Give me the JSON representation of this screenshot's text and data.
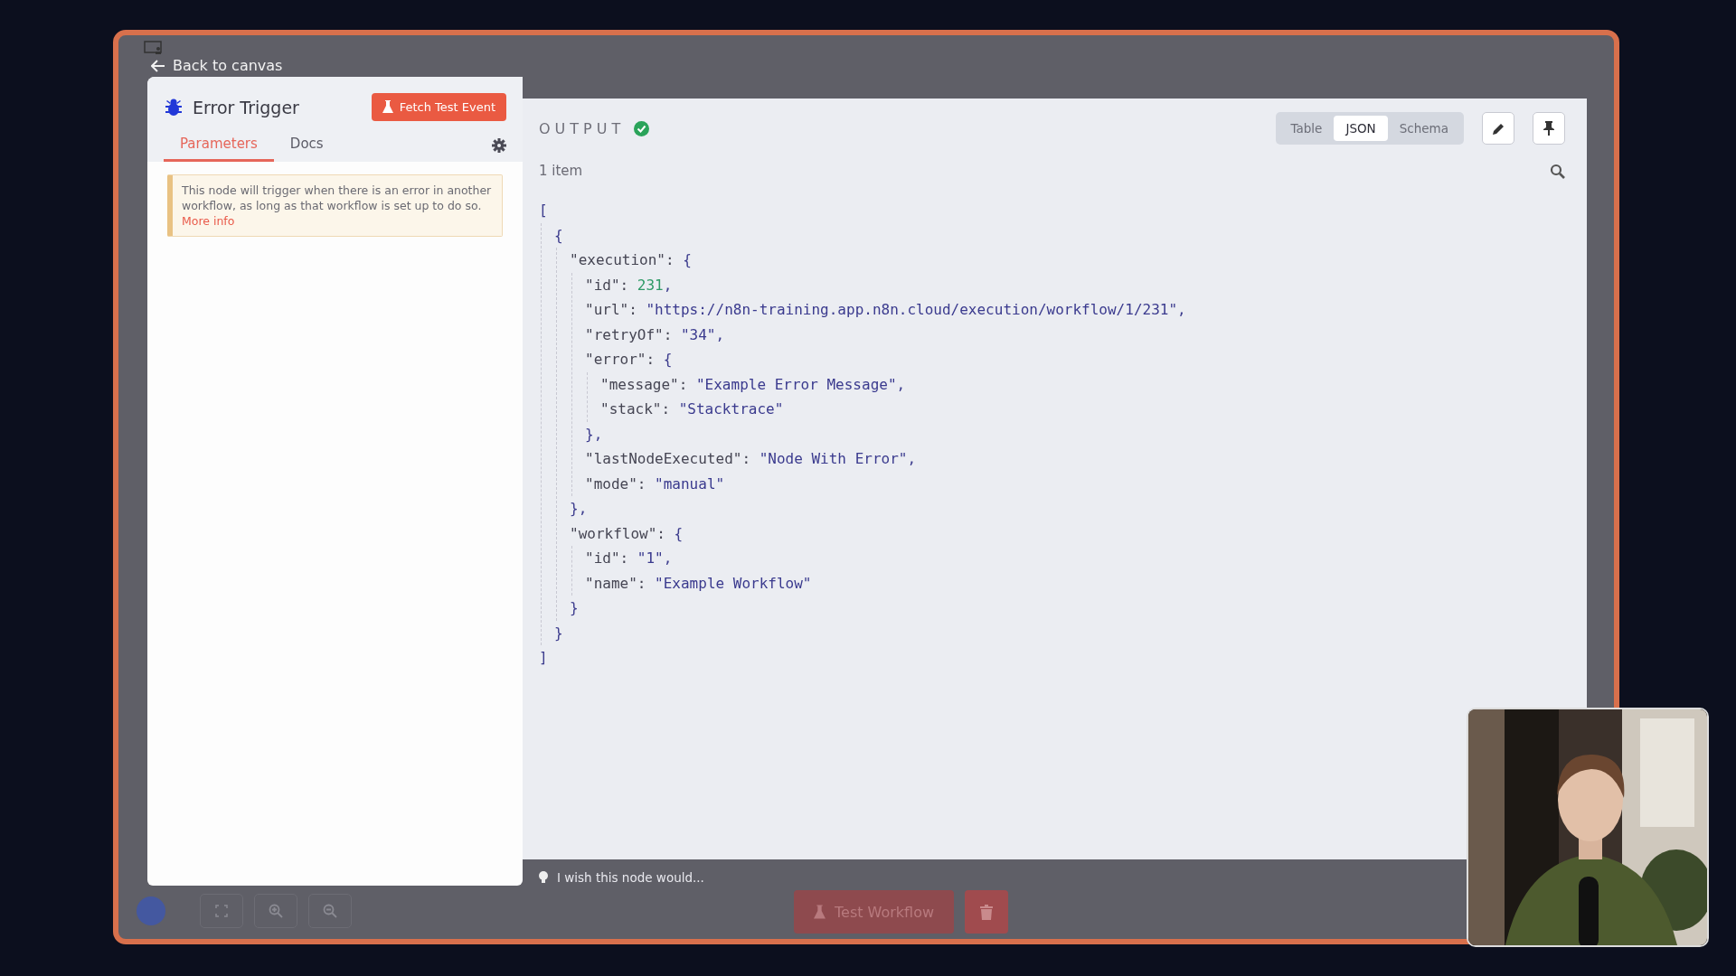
{
  "back_link": "Back to canvas",
  "node_panel": {
    "title": "Error Trigger",
    "fetch_button": "Fetch Test Event",
    "tabs": [
      {
        "label": "Parameters",
        "selected": true
      },
      {
        "label": "Docs",
        "selected": false
      }
    ],
    "notice": {
      "text": "This node will trigger when there is an error in another workflow, as long as that workflow is set up to do so.",
      "link": "More info"
    }
  },
  "output": {
    "title": "OUTPUT",
    "success": true,
    "view_tabs": [
      {
        "label": "Table",
        "selected": false
      },
      {
        "label": "JSON",
        "selected": true
      },
      {
        "label": "Schema",
        "selected": false
      }
    ],
    "item_count": "1 item",
    "json": {
      "kind": "block",
      "open": "[",
      "close": "]",
      "children": [
        {
          "kind": "block",
          "open": "{",
          "close": "}",
          "children": [
            {
              "kind": "block",
              "key": "\"execution\":",
              "open": "{",
              "close": "},",
              "children": [
                {
                  "kind": "number",
                  "key": "\"id\":",
                  "value": "231",
                  "trail": ","
                },
                {
                  "kind": "string",
                  "key": "\"url\":",
                  "value": "\"https://n8n-training.app.n8n.cloud/execution/workflow/1/231\"",
                  "trail": ","
                },
                {
                  "kind": "string",
                  "key": "\"retryOf\":",
                  "value": "\"34\"",
                  "trail": ","
                },
                {
                  "kind": "block",
                  "key": "\"error\":",
                  "open": "{",
                  "close": "},",
                  "children": [
                    {
                      "kind": "string",
                      "key": "\"message\":",
                      "value": "\"Example Error Message\"",
                      "trail": ","
                    },
                    {
                      "kind": "string",
                      "key": "\"stack\":",
                      "value": "\"Stacktrace\""
                    }
                  ]
                },
                {
                  "kind": "string",
                  "key": "\"lastNodeExecuted\":",
                  "value": "\"Node With Error\"",
                  "trail": ","
                },
                {
                  "kind": "string",
                  "key": "\"mode\":",
                  "value": "\"manual\""
                }
              ]
            },
            {
              "kind": "block",
              "key": "\"workflow\":",
              "open": "{",
              "close": "}",
              "children": [
                {
                  "kind": "string",
                  "key": "\"id\":",
                  "value": "\"1\"",
                  "trail": ","
                },
                {
                  "kind": "string",
                  "key": "\"name\":",
                  "value": "\"Example Workflow\""
                }
              ]
            }
          ]
        }
      ]
    },
    "feedback_placeholder": "I wish this node would..."
  },
  "canvas_footer": {
    "test_button": "Test Workflow"
  }
}
